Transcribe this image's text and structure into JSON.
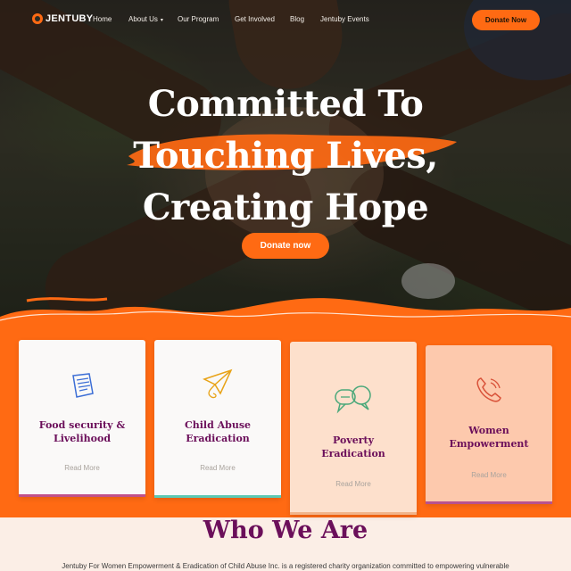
{
  "brand": {
    "name": "JENTUBY",
    "accent": "#ff6a13",
    "purple": "#6b0f5a"
  },
  "nav": {
    "items": [
      {
        "label": "Home"
      },
      {
        "label": "About Us",
        "chevron": "▾"
      },
      {
        "label": "Our Program"
      },
      {
        "label": "Get Involved"
      },
      {
        "label": "Blog"
      },
      {
        "label": "Jentuby Events"
      }
    ],
    "donate_label": "Donate Now"
  },
  "hero": {
    "title_lines": [
      "Committed To",
      "Touching Lives,",
      "Creating Hope"
    ],
    "cta_label": "Donate now"
  },
  "cards": [
    {
      "title_lines": [
        "Food security &",
        "Livelihood"
      ],
      "read_more": "Read More",
      "icon": "document-icon",
      "bar_color": "#c0508a"
    },
    {
      "title_lines": [
        "Child Abuse",
        "Eradication"
      ],
      "read_more": "Read More",
      "icon": "paper-plane-icon",
      "bar_color": "#5cc9b4"
    },
    {
      "title_lines": [
        "Poverty",
        "Eradication"
      ],
      "read_more": "Read More",
      "icon": "chat-bubbles-icon",
      "bar_color": "#f2b48a"
    },
    {
      "title_lines": [
        "Women",
        "Empowerment"
      ],
      "read_more": "Read More",
      "icon": "phone-icon",
      "bar_color": "#b8528e"
    }
  ],
  "who": {
    "heading": "Who We Are",
    "description": "Jentuby For Women Empowerment & Eradication of Child Abuse Inc. is a registered charity organization committed to empowering vulnerable"
  }
}
